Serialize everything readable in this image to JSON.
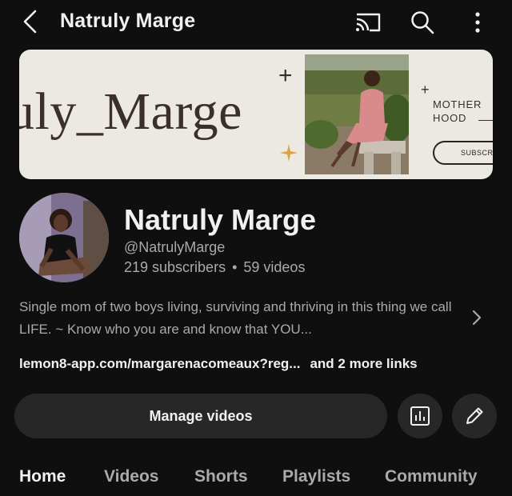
{
  "topbar": {
    "title": "Natruly Marge",
    "icons": [
      "back-arrow-icon",
      "cast-icon",
      "search-icon",
      "more-vertical-icon"
    ]
  },
  "banner": {
    "script_text": "uly_Marge",
    "side_text_line1": "MOTHER",
    "side_text_line2": "HOOD",
    "subscribe_text": "SUBSCRI"
  },
  "channel": {
    "name": "Natruly Marge",
    "handle": "@NatrulyMarge",
    "subscribers": "219 subscribers",
    "separator": "•",
    "videos": "59 videos",
    "description": "Single mom of two boys living, surviving and thriving in this thing we call LIFE. ~ Know who you are and know that YOU...",
    "link": "lemon8-app.com/margarenacomeaux?reg...",
    "more_links": "and 2 more links"
  },
  "actions": {
    "manage_label": "Manage videos",
    "analytics_icon": "analytics-icon",
    "edit_icon": "pencil-icon"
  },
  "tabs": [
    {
      "label": "Home",
      "active": true
    },
    {
      "label": "Videos",
      "active": false
    },
    {
      "label": "Shorts",
      "active": false
    },
    {
      "label": "Playlists",
      "active": false
    },
    {
      "label": "Community",
      "active": false
    }
  ],
  "colors": {
    "background": "#0f0f0f",
    "surface": "#272727",
    "text_primary": "#f1f1f1",
    "text_secondary": "#aaaaaa",
    "banner_bg": "#ece9e2"
  }
}
